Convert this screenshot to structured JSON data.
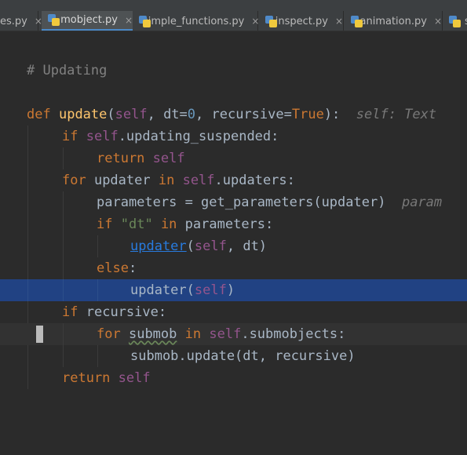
{
  "tabs": [
    {
      "label": "es.py",
      "active": false
    },
    {
      "label": "mobject.py",
      "active": true
    },
    {
      "label": "simple_functions.py",
      "active": false
    },
    {
      "label": "inspect.py",
      "active": false
    },
    {
      "label": "animation.py",
      "active": false
    },
    {
      "label": "s",
      "active": false
    }
  ],
  "close_glyph": "×",
  "icon": "python-file-icon",
  "colors": {
    "background": "#2b2b2b",
    "keyword": "#cc7832",
    "self": "#94558d",
    "function": "#ffc66d",
    "selection": "#214283"
  },
  "code": {
    "l1": {
      "cmt": "# Updating"
    },
    "l2": {
      "kw": "def",
      "fn": "update",
      "p1": "(",
      "self": "self",
      "p2": ", dt=",
      "num": "0",
      "p3": ", recursive=",
      "kw2": "True",
      "p4": "):",
      "hint": "self: Text"
    },
    "l3": {
      "kw": "if",
      "self": "self",
      "rest": ".updating_suspended:"
    },
    "l4": {
      "kw": "return",
      "self": "self"
    },
    "l5": {
      "kw": "for",
      "a": " updater ",
      "kw2": "in",
      "self": "self",
      "rest": ".updaters:"
    },
    "l6": {
      "text": "parameters = get_parameters(updater)",
      "hint": "param"
    },
    "l7": {
      "kw": "if",
      "str": "\"dt\"",
      "kw2": "in",
      "rest": "parameters:"
    },
    "l8": {
      "link": "updater",
      "p1": "(",
      "self": "self",
      "p2": ", dt)"
    },
    "l9": {
      "kw": "else",
      "p": ":"
    },
    "l10": {
      "a": "updater(",
      "self": "self",
      "b": ")"
    },
    "l11": {
      "kw": "if",
      "rest": "recursive:"
    },
    "l12": {
      "kw": "for",
      "typo": "submob",
      "kw2": "in",
      "self": "self",
      "rest": ".submobjects:"
    },
    "l13": {
      "text": "submob.update(dt, recursive)"
    },
    "l14": {
      "kw": "return",
      "self": "self"
    }
  }
}
